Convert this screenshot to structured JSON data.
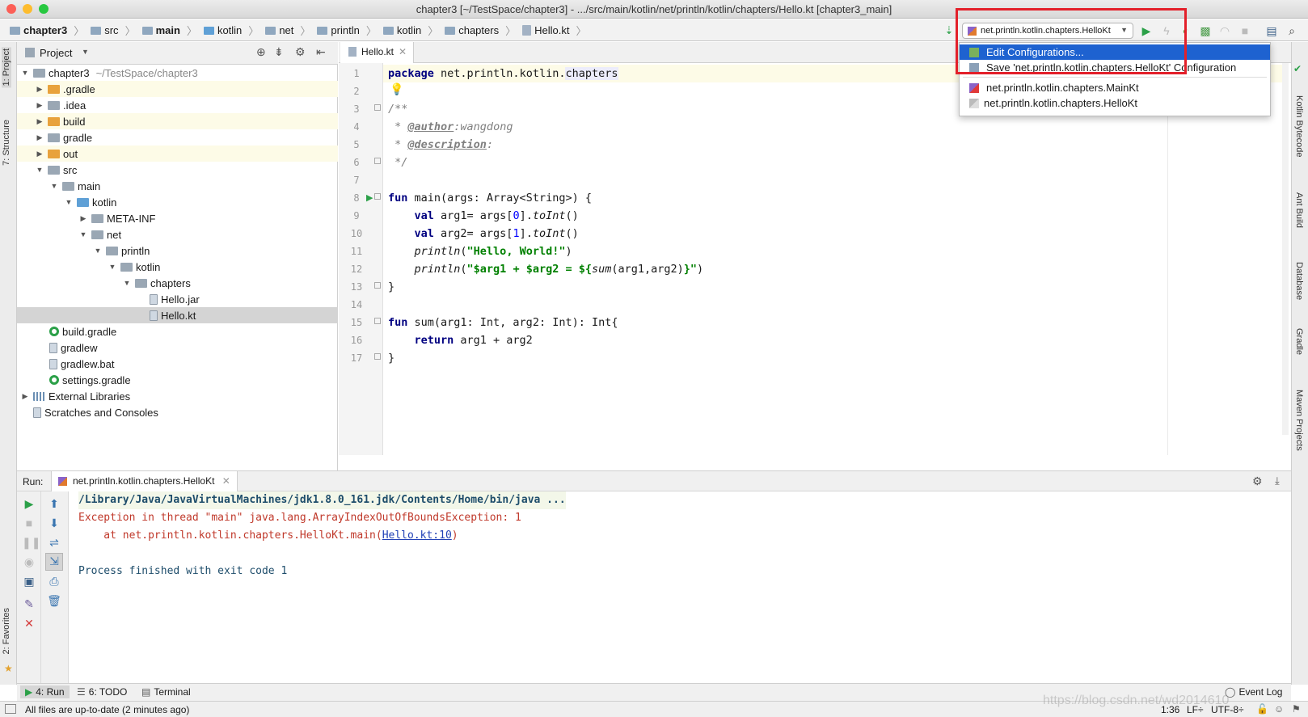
{
  "window": {
    "title": "chapter3 [~/TestSpace/chapter3] - .../src/main/kotlin/net/println/kotlin/chapters/Hello.kt [chapter3_main]"
  },
  "breadcrumb": [
    "chapter3",
    "src",
    "main",
    "kotlin",
    "net",
    "println",
    "kotlin",
    "chapters",
    "Hello.kt"
  ],
  "run_config": {
    "selected": "net.println.kotlin.chapters.HelloKt"
  },
  "run_config_menu": {
    "items": [
      "Edit Configurations...",
      "Save 'net.println.kotlin.chapters.HelloKt' Configuration",
      "net.println.kotlin.chapters.MainKt",
      "net.println.kotlin.chapters.HelloKt"
    ]
  },
  "left_stripe": {
    "project": "1: Project",
    "structure": "7: Structure",
    "favorites": "2: Favorites"
  },
  "right_stripe": [
    "Kotlin Bytecode",
    "Ant Build",
    "Database",
    "Gradle",
    "Maven Projects"
  ],
  "project_panel": {
    "title": "Project",
    "root": "chapter3",
    "root_path": "~/TestSpace/chapter3",
    "items": [
      ".gradle",
      ".idea",
      "build",
      "gradle",
      "out",
      "src",
      "main",
      "kotlin",
      "META-INF",
      "net",
      "println",
      "kotlin",
      "chapters",
      "Hello.jar",
      "Hello.kt",
      "build.gradle",
      "gradlew",
      "gradlew.bat",
      "settings.gradle",
      "External Libraries",
      "Scratches and Consoles"
    ]
  },
  "editor": {
    "tab": "Hello.kt",
    "lines": [
      "1",
      "2",
      "3",
      "4",
      "5",
      "6",
      "7",
      "8",
      "9",
      "10",
      "11",
      "12",
      "13",
      "14",
      "15",
      "16",
      "17"
    ],
    "code": {
      "l1a": "package ",
      "l1b": "net.println.kotlin.",
      "l1c": "chapters",
      "l3": "/**",
      "l4a": " * ",
      "l4b": "@author",
      "l4c": ":wangdong",
      "l5a": " * ",
      "l5b": "@description",
      "l5c": ":",
      "l6": " */",
      "l8a": "fun ",
      "l8b": "main(args: Array<String>) {",
      "l9a": "    val ",
      "l9b": "arg1= args[",
      "l9c": "0",
      "l9d": "].",
      "l9e": "toInt",
      "l9f": "()",
      "l10a": "    val ",
      "l10b": "arg2= args[",
      "l10c": "1",
      "l10d": "].",
      "l10e": "toInt",
      "l10f": "()",
      "l11a": "    println",
      "l11b": "(",
      "l11c": "\"Hello, World!\"",
      "l11d": ")",
      "l12a": "    println",
      "l12b": "(",
      "l12c": "\"$arg1 + $arg2 = ${",
      "l12d": "sum",
      "l12e": "(arg1,arg2)",
      "l12f": "}\"",
      "l12g": ")",
      "l13": "}",
      "l15a": "fun ",
      "l15b": "sum(arg1: Int, arg2: Int): Int{",
      "l16a": "    return ",
      "l16b": "arg1 + arg2",
      "l17": "}"
    }
  },
  "run_panel": {
    "label": "Run:",
    "tab": "net.println.kotlin.chapters.HelloKt",
    "output": [
      "/Library/Java/JavaVirtualMachines/jdk1.8.0_161.jdk/Contents/Home/bin/java ...",
      "Exception in thread \"main\" java.lang.ArrayIndexOutOfBoundsException: 1",
      "    at net.println.kotlin.chapters.HelloKt.main(",
      "Hello.kt:10",
      ")",
      "Process finished with exit code 1"
    ]
  },
  "bottom_tabs": {
    "run": "4: Run",
    "todo": "6: TODO",
    "terminal": "Terminal",
    "event_log": "Event Log"
  },
  "status": {
    "message": "All files are up-to-date (2 minutes ago)",
    "position": "1:36",
    "line_sep": "LF÷",
    "encoding": "UTF-8÷"
  },
  "watermark": "https://blog.csdn.net/wd2014610"
}
